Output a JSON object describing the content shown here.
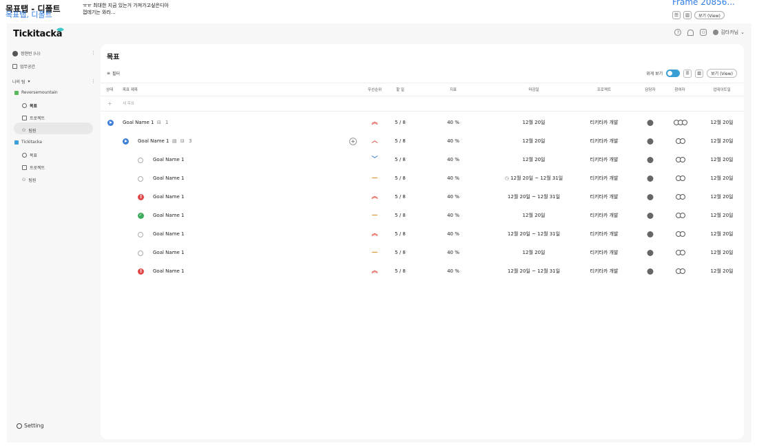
{
  "canvas": {
    "title": "목표탭 - 디폴트",
    "subtitle": "목표탭, 디폴트",
    "note_line1": "ㅠㅠ 최대한 지금 있는거 가져가고싶은디아",
    "note_line2": "껍데기는 와라...",
    "frame_label": "Frame 20856...",
    "view_label": "보기 (View)"
  },
  "app": {
    "logo": "Tickitacka",
    "user_name": "김타카님",
    "help_icon": "question-icon",
    "bell_icon": "bell-icon",
    "people_icon": "people-icon"
  },
  "sidebar": {
    "me": "정현빈 (나)",
    "workspace": "업무공간",
    "my_team": "나의 팀",
    "teams": [
      {
        "name": "Reversemountain",
        "color": "#5cb85c",
        "items": [
          "목표",
          "프로젝트",
          "팀원"
        ]
      },
      {
        "name": "Tickitacka",
        "color": "#3a9fd6",
        "items": [
          "목표",
          "프로젝트",
          "팀원"
        ]
      }
    ],
    "setting": "Setting"
  },
  "main": {
    "title": "목표",
    "filter": "필터",
    "wide_view": "위게 보기",
    "view_button": "보기 (View)",
    "columns": {
      "status": "상태",
      "goal_title": "목표 제목",
      "priority": "우선순위",
      "todo": "할 일",
      "metric": "지표",
      "deadline": "마감일",
      "project": "프로젝트",
      "owner": "담당자",
      "participants": "참여자",
      "updated": "업데이트일"
    },
    "new_goal": "새 목표",
    "rows": [
      {
        "status": "play",
        "indent": 0,
        "name": "Goal Name 1",
        "sub_count": "1",
        "priority": "high",
        "todo": "5 / 8",
        "metric": "40 %",
        "deadline": "12월 20일",
        "project": "티키타카 개발",
        "participants": 3,
        "updated": "12월 20일"
      },
      {
        "status": "play",
        "indent": 1,
        "name": "Goal Name 1",
        "sub_count": "3",
        "priority": "medium",
        "todo": "5 / 8",
        "metric": "40 %",
        "deadline": "12월 20일",
        "project": "티키타카 개발",
        "participants": 2,
        "updated": "12월 20일"
      },
      {
        "status": "empty",
        "indent": 2,
        "name": "Goal Name 1",
        "priority": "low",
        "todo": "5 / 8",
        "metric": "40 %",
        "deadline": "12월 20일",
        "project": "티키타카 개발",
        "participants": 2,
        "updated": "12월 20일"
      },
      {
        "status": "empty",
        "indent": 2,
        "name": "Goal Name 1",
        "priority": "none",
        "todo": "5 / 8",
        "metric": "40 %",
        "deadline": "12월 20일 ~ 12월 31일",
        "deadline_warn": true,
        "project": "티키타카 개발",
        "participants": 2,
        "updated": "12월 20일"
      },
      {
        "status": "error",
        "indent": 2,
        "name": "Goal Name 1",
        "priority": "high",
        "todo": "5 / 8",
        "metric": "40 %",
        "deadline": "12월 20일 ~ 12월 31일",
        "project": "티키타카 개발",
        "participants": 2,
        "updated": "12월 20일"
      },
      {
        "status": "done",
        "indent": 2,
        "name": "Goal Name 1",
        "priority": "none",
        "todo": "5 / 8",
        "metric": "40 %",
        "deadline": "12월 20일",
        "project": "티키타카 개발",
        "participants": 2,
        "updated": "12월 20일"
      },
      {
        "status": "empty",
        "indent": 2,
        "name": "Goal Name 1",
        "priority": "high",
        "todo": "5 / 8",
        "metric": "40 %",
        "deadline": "12월 20일 ~ 12월 31일",
        "project": "티키타카 개발",
        "participants": 2,
        "updated": "12월 20일"
      },
      {
        "status": "empty",
        "indent": 2,
        "name": "Goal Name 1",
        "priority": "none",
        "todo": "5 / 8",
        "metric": "40 %",
        "deadline": "12월 20일",
        "project": "티키타카 개발",
        "participants": 2,
        "updated": "12월 20일"
      },
      {
        "status": "error",
        "indent": 2,
        "name": "Goal Name 1",
        "priority": "high",
        "todo": "5 / 8",
        "metric": "40 %",
        "deadline": "12월 20일 ~ 12월 31일",
        "project": "티키타카 개발",
        "participants": 2,
        "updated": "12월 20일"
      }
    ]
  }
}
